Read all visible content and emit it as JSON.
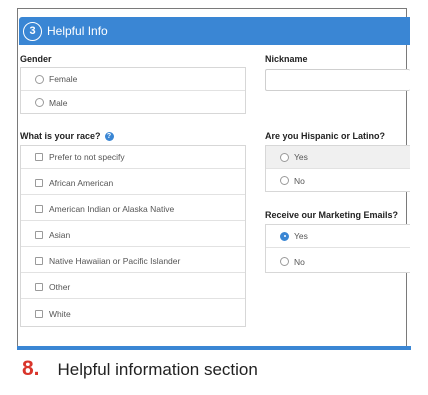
{
  "section": {
    "step": "3",
    "title": "Helpful Info"
  },
  "gender": {
    "label": "Gender",
    "options": [
      "Female",
      "Male"
    ]
  },
  "nickname": {
    "label": "Nickname",
    "value": ""
  },
  "race": {
    "label": "What is your race?",
    "help_icon": "question-circle-icon",
    "options": [
      "Prefer to not specify",
      "African American",
      "American Indian or Alaska Native",
      "Asian",
      "Native Hawaiian or Pacific Islander",
      "Other",
      "White"
    ]
  },
  "hispanic": {
    "label": "Are you Hispanic or Latino?",
    "options": [
      "Yes",
      "No"
    ]
  },
  "marketing": {
    "label": "Receive our Marketing Emails?",
    "options": [
      "Yes",
      "No"
    ],
    "selected": "Yes"
  },
  "caption": {
    "number": "8.",
    "text": "Helpful information section"
  },
  "colors": {
    "accent": "#3a86d4",
    "caption_number": "#d9352b"
  }
}
